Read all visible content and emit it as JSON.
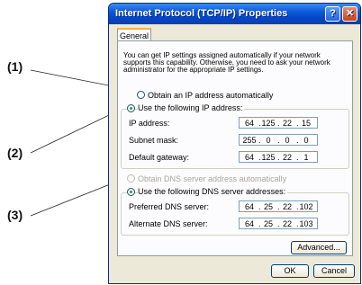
{
  "callouts": [
    "(1)",
    "(2)",
    "(3)"
  ],
  "window": {
    "title": "Internet Protocol (TCP/IP) Properties",
    "help_glyph": "?",
    "close_glyph": "✕"
  },
  "tab": {
    "label": "General"
  },
  "description": "You can get IP settings assigned automatically if your network supports this capability. Otherwise, you need to ask your network administrator for the appropriate IP settings.",
  "ip_section": {
    "auto_label": "Obtain an IP address automatically",
    "auto_selected": false,
    "manual_label": "Use the following IP address:",
    "manual_selected": true,
    "fields": [
      {
        "label": "IP address:",
        "octets": [
          "64",
          "125",
          "22",
          "15"
        ]
      },
      {
        "label": "Subnet mask:",
        "octets": [
          "255",
          "0",
          "0",
          "0"
        ]
      },
      {
        "label": "Default gateway:",
        "octets": [
          "64",
          "125",
          "22",
          "1"
        ]
      }
    ]
  },
  "dns_section": {
    "auto_label": "Obtain DNS server address automatically",
    "auto_enabled": false,
    "manual_label": "Use the following DNS server addresses:",
    "manual_selected": true,
    "fields": [
      {
        "label": "Preferred DNS server:",
        "octets": [
          "64",
          "25",
          "22",
          "102"
        ]
      },
      {
        "label": "Alternate DNS server:",
        "octets": [
          "64",
          "25",
          "22",
          "103"
        ]
      }
    ]
  },
  "buttons": {
    "advanced": "Advanced...",
    "ok": "OK",
    "cancel": "Cancel"
  }
}
